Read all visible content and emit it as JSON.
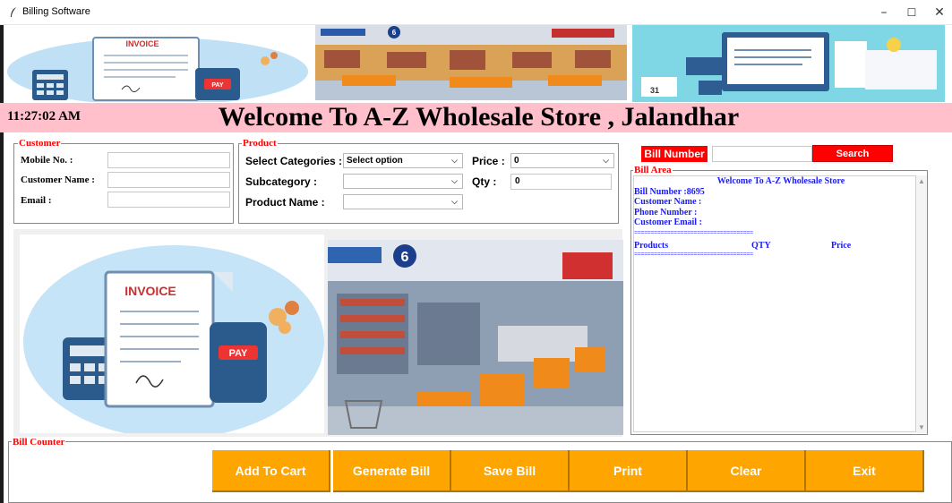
{
  "window": {
    "title": "Billing Software",
    "minimize_glyph": "–",
    "maximize_glyph": "☐",
    "close_glyph": "✕"
  },
  "header": {
    "clock": "11:27:02 AM",
    "title": "Welcome To A-Z Wholesale Store , Jalandhar"
  },
  "banner": {
    "invoice_word": "INVOICE",
    "pay_word": "PAY",
    "aisle_sign": "6",
    "calendar_day": "31"
  },
  "customer": {
    "legend": "Customer",
    "mobile_label": "Mobile No. :",
    "name_label": "Customer Name :",
    "email_label": "Email :",
    "mobile_value": "",
    "name_value": "",
    "email_value": ""
  },
  "product": {
    "legend": "Product",
    "category_label": "Select Categories :",
    "category_value": "Select option",
    "subcategory_label": "Subcategory :",
    "subcategory_value": "",
    "product_name_label": "Product Name :",
    "product_name_value": "",
    "price_label": "Price :",
    "price_value": "0",
    "qty_label": "Qty :",
    "qty_value": "0"
  },
  "bill": {
    "number_label": "Bill Number :",
    "number_input": "",
    "search_label": "Search",
    "area_legend": "Bill Area",
    "store_line": "Welcome To A-Z Wholesale Store",
    "bill_number_line": "Bill Number :8695",
    "customer_name_line": "Customer Name :",
    "phone_line": "Phone Number :",
    "email_line": "Customer Email :",
    "divider": "====================================",
    "col_products": "Products",
    "col_qty": "QTY",
    "col_price": "Price"
  },
  "counter": {
    "legend": "Bill Counter",
    "buttons": {
      "add_to_cart": "Add To Cart",
      "generate_bill": "Generate Bill",
      "save_bill": "Save Bill",
      "print": "Print",
      "clear": "Clear",
      "exit": "Exit"
    }
  },
  "colors": {
    "accent_red": "#ff0000",
    "welcome_bar": "#ffc0cb",
    "button_orange": "#ffa500",
    "bill_text_blue": "#1a1aff"
  }
}
